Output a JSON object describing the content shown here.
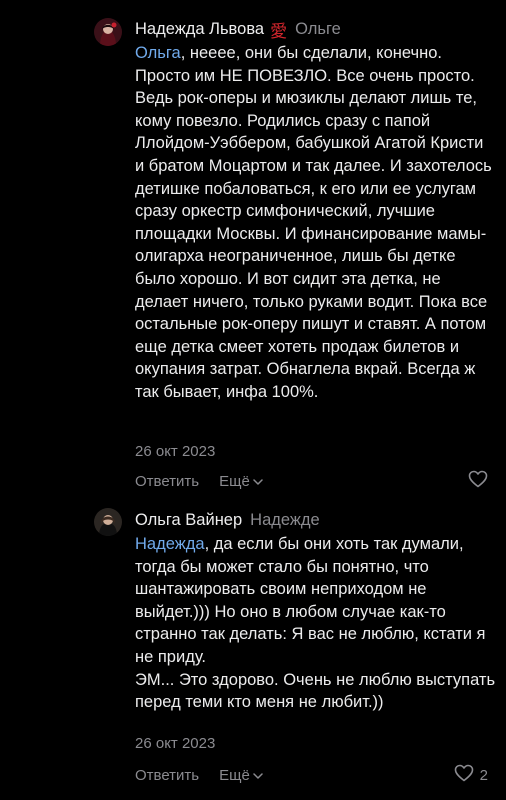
{
  "comments": [
    {
      "author": "Надежда Львова",
      "author_badge": "愛",
      "reply_to": "Ольге",
      "mention": "Ольга",
      "text": ", нееее, они бы сделали, конечно. Просто им НЕ ПОВЕЗЛО. Все очень просто. Ведь рок-оперы и мюзиклы делают лишь те, кому повезло. Родились сразу с папой Ллойдом-Уэббером, бабушкой Агатой Кристи и братом Моцартом и так далее. И захотелось детишке побаловаться, к его или ее услугам сразу оркестр симфонический, лучшие площадки Москвы. И финансирование мамы-олигарха неограниченное, лишь бы детке было хорошо. И вот сидит эта детка, не делает ничего, только руками водит. Пока все остальные рок-оперу пишут и ставят. А потом еще детка смеет хотеть продаж билетов и окупания затрат. Обнаглела вкрай. Всегда ж так бывает, инфа 100%.",
      "date": "26 окт 2023",
      "reply_label": "Ответить",
      "more_label": "Ещё",
      "like_count": ""
    },
    {
      "author": "Ольга Вайнер",
      "reply_to": "Надежде",
      "mention": "Надежда",
      "text": ", да если бы они хоть так думали, тогда бы может стало бы понятно, что шантажировать своим неприходом не выйдет.))) Но оно в любом случае как-то странно так делать: Я вас не люблю, кстати я не приду.\nЭМ... Это здорово. Очень не люблю выступать перед теми кто меня не любит.))",
      "date": "26 окт 2023",
      "reply_label": "Ответить",
      "more_label": "Ещё",
      "like_count": "2"
    }
  ],
  "icons": {
    "more": "chevron-down-icon",
    "like": "heart-icon",
    "badge": "love-kanji-icon"
  },
  "colors": {
    "background": "#000000",
    "text": "#ececed",
    "secondary": "#8b8b90",
    "mention": "#71aaeb",
    "badge": "#d3262d"
  }
}
